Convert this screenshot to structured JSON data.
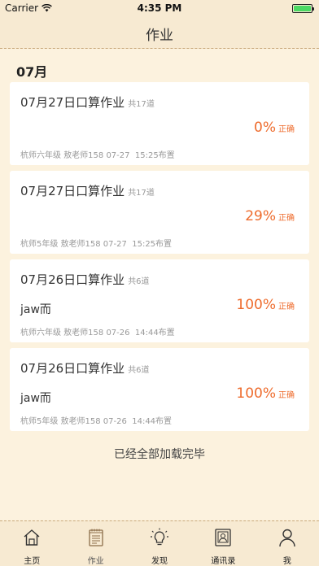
{
  "status_bar": {
    "carrier": "Carrier",
    "time": "4:35 PM"
  },
  "nav": {
    "title": "作业"
  },
  "section": {
    "month": "07月"
  },
  "cards": [
    {
      "title": "07月27日口算作业",
      "total": "共17道",
      "subtitle": "",
      "percent": "0%",
      "correct_label": "正确",
      "meta": "杭师六年级 敖老师158 07-27  15:25布置"
    },
    {
      "title": "07月27日口算作业",
      "total": "共17道",
      "subtitle": "",
      "percent": "29%",
      "correct_label": "正确",
      "meta": "杭师5年级 敖老师158 07-27  15:25布置"
    },
    {
      "title": "07月26日口算作业",
      "total": "共6道",
      "subtitle": "jaw而",
      "percent": "100%",
      "correct_label": "正确",
      "meta": "杭师六年级 敖老师158 07-26  14:44布置"
    },
    {
      "title": "07月26日口算作业",
      "total": "共6道",
      "subtitle": "jaw而",
      "percent": "100%",
      "correct_label": "正确",
      "meta": "杭师5年级 敖老师158 07-26  14:44布置"
    }
  ],
  "end_text": "已经全部加载完毕",
  "tabs": [
    {
      "label": "主页",
      "icon": "home-icon"
    },
    {
      "label": "作业",
      "icon": "homework-icon"
    },
    {
      "label": "发现",
      "icon": "discover-icon"
    },
    {
      "label": "通讯录",
      "icon": "contacts-icon"
    },
    {
      "label": "我",
      "icon": "profile-icon"
    }
  ],
  "colors": {
    "accent": "#ee6b2c",
    "background": "#fcf2de",
    "bar": "#f7ead2"
  }
}
